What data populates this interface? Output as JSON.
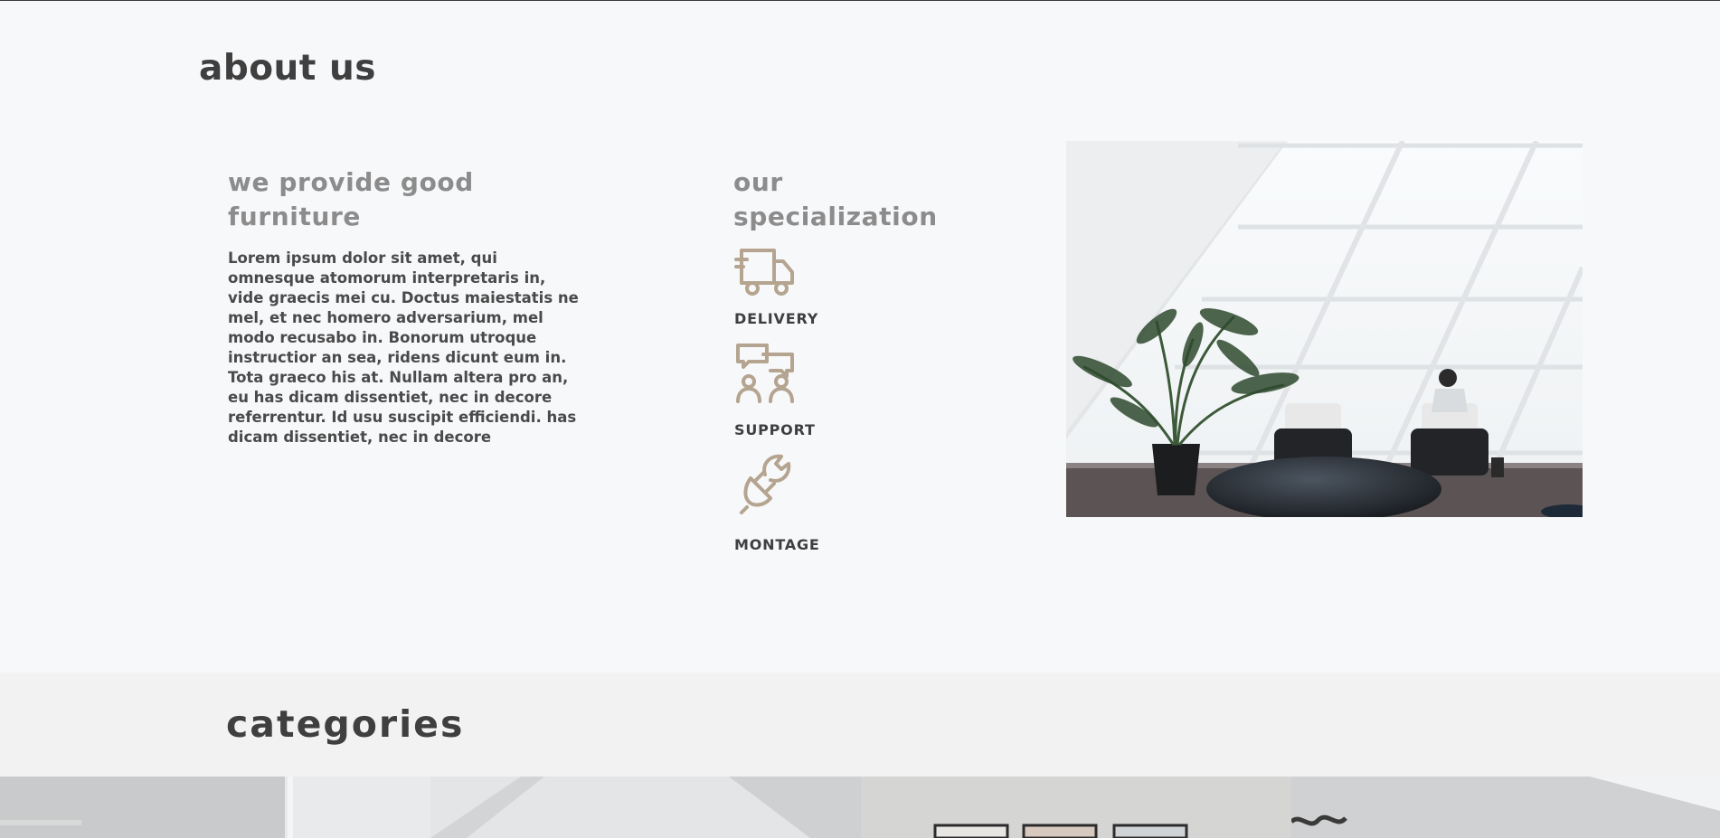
{
  "about": {
    "title": "about us",
    "left_heading": "we provide good furniture",
    "left_body": "Lorem ipsum dolor sit amet, qui omnesque atomorum interpretaris in, vide graecis mei cu. Doctus maiestatis ne mel, et nec homero adversarium, mel modo recusabo in. Bonorum utroque instructior an sea, ridens dicunt eum in. Tota graeco his at. Nullam altera pro an, eu has dicam dissentiet, nec in decore referrentur. Id usu suscipit efficiendi. has dicam dissentiet, nec in decore",
    "right_heading": "our specialization",
    "specializations": [
      {
        "label": "DELIVERY",
        "icon": "delivery-truck-icon"
      },
      {
        "label": "SUPPORT",
        "icon": "support-people-chat-icon"
      },
      {
        "label": "MONTAGE",
        "icon": "plug-wrench-icon"
      }
    ]
  },
  "categories": {
    "title": "categories"
  },
  "colors": {
    "background": "#f7f8fa",
    "band": "#f2f2f3",
    "heading_dark": "#3f3f3f",
    "heading_muted": "#8c8c8c",
    "icon_accent": "#b5a48f"
  }
}
